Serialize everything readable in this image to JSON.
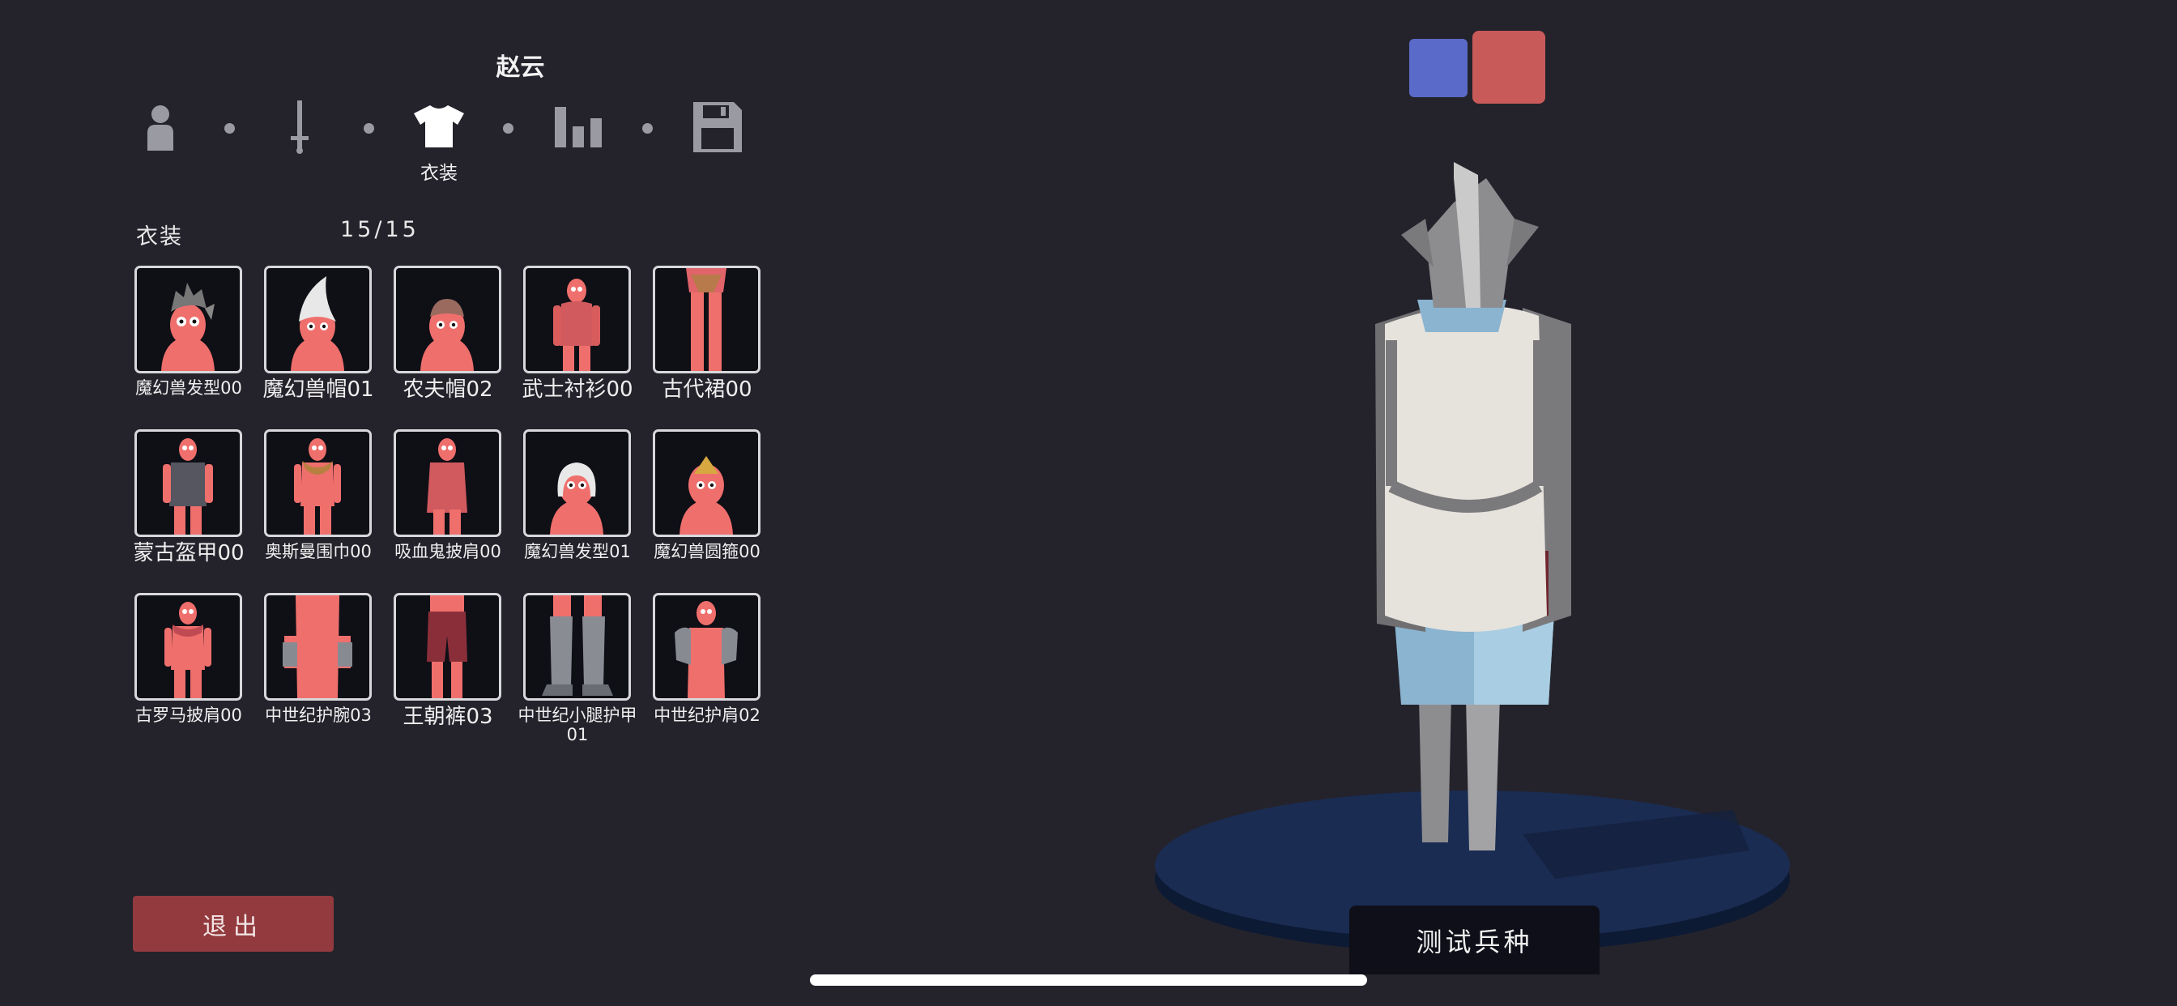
{
  "unit": {
    "name": "赵云"
  },
  "steps": [
    {
      "id": "body",
      "icon": "person-icon",
      "active": false
    },
    {
      "id": "weapon",
      "icon": "sword-icon",
      "active": false
    },
    {
      "id": "clothing",
      "icon": "shirt-icon",
      "active": true,
      "label": "衣装"
    },
    {
      "id": "stats",
      "icon": "bar-chart-icon",
      "active": false
    },
    {
      "id": "save",
      "icon": "floppy-disk-icon",
      "active": false
    }
  ],
  "section": {
    "title": "衣装",
    "count": "15/15"
  },
  "items": [
    {
      "label": "魔幻兽发型00",
      "icon": "hair-spiky-icon"
    },
    {
      "label": "魔幻兽帽01",
      "icon": "hat-horn-icon"
    },
    {
      "label": "农夫帽02",
      "icon": "farmer-hat-icon"
    },
    {
      "label": "武士衬衫00",
      "icon": "samurai-shirt-icon"
    },
    {
      "label": "古代裙00",
      "icon": "ancient-skirt-icon"
    },
    {
      "label": "蒙古盔甲00",
      "icon": "mongol-armor-icon"
    },
    {
      "label": "奥斯曼围巾00",
      "icon": "ottoman-scarf-icon"
    },
    {
      "label": "吸血鬼披肩00",
      "icon": "vampire-cape-icon"
    },
    {
      "label": "魔幻兽发型01",
      "icon": "hair-white-icon"
    },
    {
      "label": "魔幻兽圆箍00",
      "icon": "crown-icon"
    },
    {
      "label": "古罗马披肩00",
      "icon": "roman-cape-icon"
    },
    {
      "label": "中世纪护腕03",
      "icon": "bracer-icon"
    },
    {
      "label": "王朝裤03",
      "icon": "dynasty-pants-icon"
    },
    {
      "label": "中世纪小腿护甲01",
      "icon": "greaves-icon"
    },
    {
      "label": "中世纪护肩02",
      "icon": "pauldron-icon"
    }
  ],
  "buttons": {
    "exit": "退出",
    "test": "测试兵种"
  },
  "teams": {
    "blue": "#5a6ac8",
    "red": "#c85a5a"
  },
  "colors": {
    "background": "#24232c",
    "exit": "#923a3e",
    "unit_skin": "#ef6f6c"
  }
}
